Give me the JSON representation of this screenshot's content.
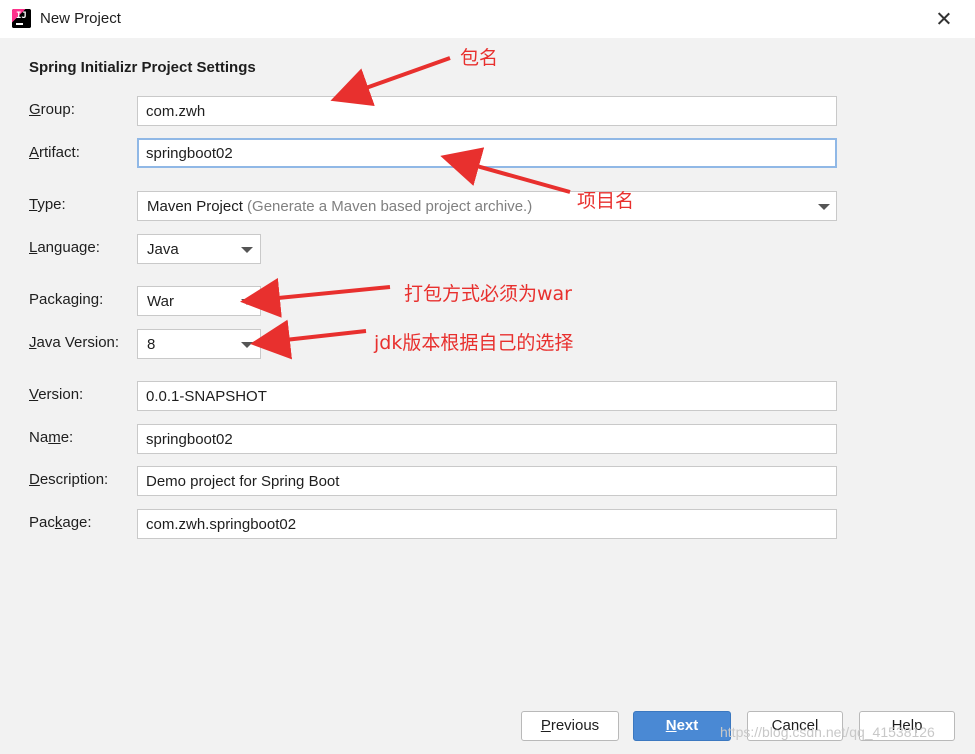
{
  "window": {
    "title": "New Project",
    "icon": "intellij-idea-icon"
  },
  "section_title": "Spring Initializr Project Settings",
  "form": {
    "group": {
      "label_pre": "",
      "label_mnemonic": "G",
      "label_post": "roup:",
      "value": "com.zwh"
    },
    "artifact": {
      "label_pre": "",
      "label_mnemonic": "A",
      "label_post": "rtifact:",
      "value": "springboot02"
    },
    "type": {
      "label_pre": "",
      "label_mnemonic": "T",
      "label_post": "ype:",
      "value": "Maven Project",
      "hint": "(Generate a Maven based project archive.)"
    },
    "language": {
      "label_pre": "",
      "label_mnemonic": "L",
      "label_post": "anguage:",
      "value": "Java"
    },
    "packaging": {
      "label_pre": "Packa",
      "label_mnemonic": "g",
      "label_post": "ing:",
      "value": "War"
    },
    "java_version": {
      "label_pre": "",
      "label_mnemonic": "J",
      "label_post": "ava Version:",
      "value": "8"
    },
    "version": {
      "label_pre": "",
      "label_mnemonic": "V",
      "label_post": "ersion:",
      "value": "0.0.1-SNAPSHOT"
    },
    "name": {
      "label_pre": "Na",
      "label_mnemonic": "m",
      "label_post": "e:",
      "value": "springboot02"
    },
    "description": {
      "label_pre": "",
      "label_mnemonic": "D",
      "label_post": "escription:",
      "value": "Demo project for Spring Boot"
    },
    "package": {
      "label_pre": "Pac",
      "label_mnemonic": "k",
      "label_post": "age:",
      "value": "com.zwh.springboot02"
    }
  },
  "buttons": {
    "previous": {
      "mnemonic": "P",
      "rest": "revious"
    },
    "next": {
      "mnemonic": "N",
      "rest": "ext"
    },
    "cancel": "Cancel",
    "help": "Help"
  },
  "annotations": {
    "group_note": "包名",
    "artifact_note": "项目名",
    "packaging_note": "打包方式必须为war",
    "java_version_note": "jdk版本根据自己的选择"
  },
  "watermark": "https://blog.csdn.net/qq_41538126",
  "colors": {
    "annotation": "#e8302e",
    "primary_button": "#4a89d4",
    "focus_border": "#90b8e6"
  }
}
